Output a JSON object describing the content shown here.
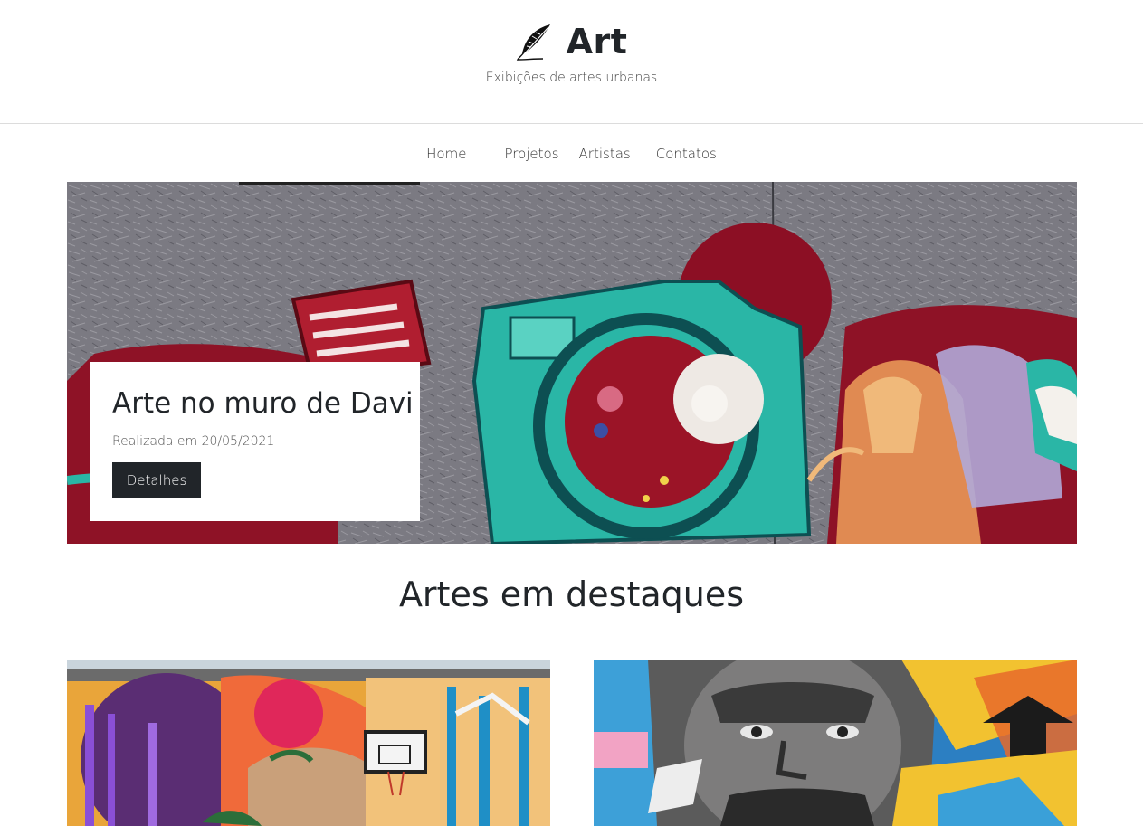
{
  "header": {
    "title": "Art",
    "tagline": "Exibições de artes urbanas"
  },
  "nav": {
    "items": [
      {
        "label": "Home"
      },
      {
        "label": "Projetos"
      },
      {
        "label": "Artistas"
      },
      {
        "label": "Contatos"
      }
    ]
  },
  "hero": {
    "title": "Arte no muro de Davi",
    "date": "Realizada em 20/05/2021",
    "button_label": "Detalhes"
  },
  "featured": {
    "title": "Artes em destaques"
  },
  "colors": {
    "text": "#212529",
    "button_bg": "#212529",
    "divider": "#dcdcdc"
  }
}
